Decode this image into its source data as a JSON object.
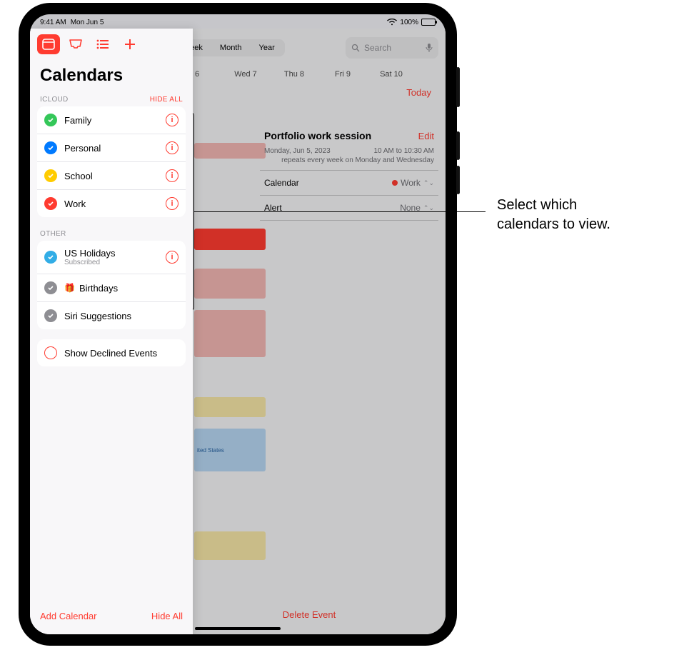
{
  "statusbar": {
    "time": "9:41 AM",
    "date": "Mon Jun 5",
    "battery": "100%"
  },
  "sidebar": {
    "title": "Calendars",
    "sections": {
      "icloud": {
        "header": "ICLOUD",
        "hide": "HIDE ALL",
        "items": [
          {
            "label": "Family",
            "color": "#34c759"
          },
          {
            "label": "Personal",
            "color": "#007aff"
          },
          {
            "label": "School",
            "color": "#ffcc00"
          },
          {
            "label": "Work",
            "color": "#ff3b30"
          }
        ]
      },
      "other": {
        "header": "OTHER",
        "items": [
          {
            "label": "US Holidays",
            "sub": "Subscribed",
            "color": "#32ade6"
          },
          {
            "label": "Birthdays",
            "color": "#8e8e93",
            "gift": true
          },
          {
            "label": "Siri Suggestions",
            "color": "#8e8e93"
          }
        ]
      }
    },
    "showDeclined": {
      "label": "Show Declined Events"
    },
    "footer": {
      "add": "Add Calendar",
      "hide": "Hide All"
    }
  },
  "main": {
    "segments": {
      "week": "Week",
      "month": "Month",
      "year": "Year"
    },
    "search": {
      "placeholder": "Search"
    },
    "today": "Today",
    "weekdays": {
      "d6": "6",
      "wed7": "Wed 7",
      "thu8": "Thu 8",
      "fri9": "Fri 9",
      "sat10": "Sat 10"
    },
    "deleteEvent": "Delete Event"
  },
  "event": {
    "title": "Portfolio work session",
    "edit": "Edit",
    "dateLine": "Monday, Jun 5, 2023",
    "timeLine": "10 AM to 10:30 AM",
    "repeat": "repeats every week on Monday and Wednesday",
    "calendarLabel": "Calendar",
    "calendarValue": "Work",
    "calendarColor": "#ff3b30",
    "alertLabel": "Alert",
    "alertValue": "None"
  },
  "callout": {
    "line1": "Select which",
    "line2": "calendars to view."
  },
  "peek": {
    "us_label": "ited States"
  }
}
